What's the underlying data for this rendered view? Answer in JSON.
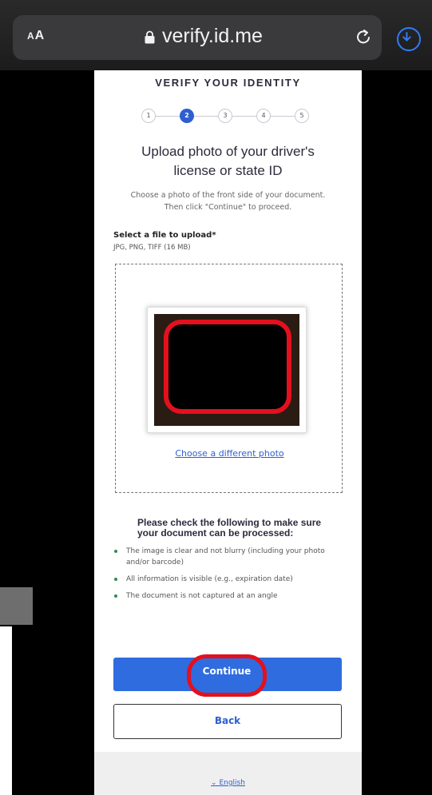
{
  "browser": {
    "text_size_button": "AA",
    "url": "verify.id.me"
  },
  "page": {
    "heading": "VERIFY YOUR IDENTITY",
    "steps": [
      "1",
      "2",
      "3",
      "4",
      "5"
    ],
    "active_step": 2,
    "title_line1": "Upload photo of your driver's",
    "title_line2": "license or state ID",
    "instructions_line1": "Choose a photo of the front side of your document.",
    "instructions_line2": "Then click \"Continue\" to proceed.",
    "select_label": "Select a file to upload*",
    "formats": "JPG, PNG, TIFF (16 MB)",
    "choose_different": "Choose a different photo",
    "checks_title_line1": "Please check the following to make sure",
    "checks_title_line2": "your document can be processed:",
    "checks": [
      "The image is clear and not blurry (including your photo and/or barcode)",
      "All information is visible (e.g., expiration date)",
      "The document is not captured at an angle"
    ],
    "continue_label": "Continue",
    "back_label": "Back",
    "language": "English"
  },
  "colors": {
    "accent": "#2f6ce0",
    "highlight": "#e3101e"
  }
}
